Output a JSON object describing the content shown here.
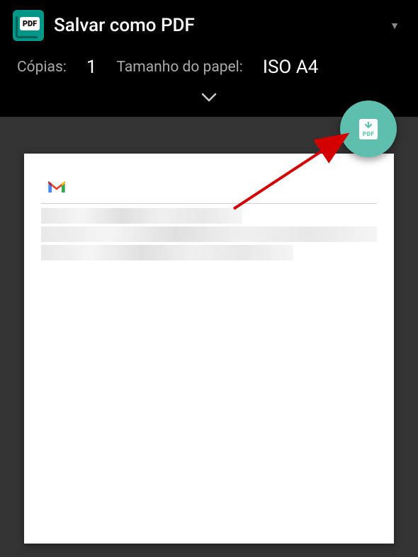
{
  "header": {
    "destination": "Salvar como PDF",
    "copies_label": "Cópias:",
    "copies_value": "1",
    "paper_label": "Tamanho do papel:",
    "paper_value": "ISO A4"
  },
  "icons": {
    "app_badge": "PDF",
    "fab_badge": "PDF"
  },
  "colors": {
    "accent": "#009688",
    "fab": "#5fbfae",
    "header_bg": "#000000",
    "preview_bg": "#333333"
  }
}
